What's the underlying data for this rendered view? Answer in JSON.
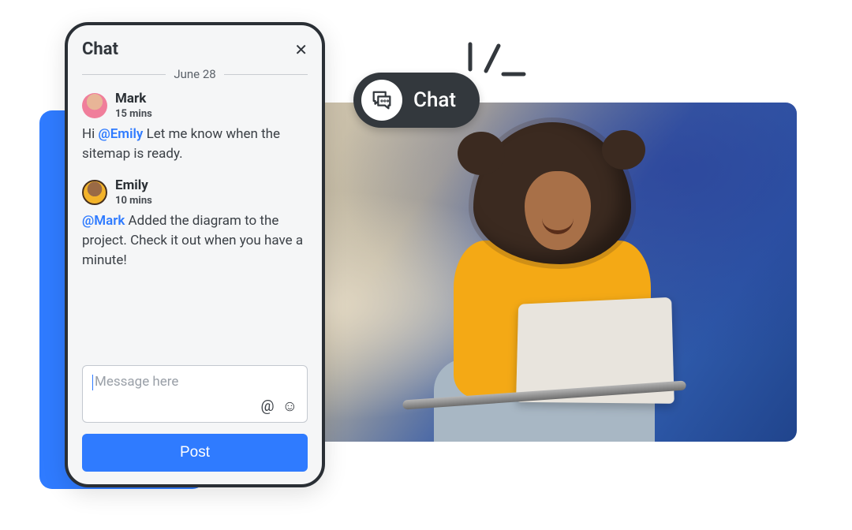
{
  "chat": {
    "title": "Chat",
    "date_label": "June 28",
    "messages": [
      {
        "author": "Mark",
        "time": "15 mins",
        "body_prefix": "Hi ",
        "mention": "@Emily",
        "body_suffix": " Let me know when the sitemap is ready.",
        "avatar": "av1"
      },
      {
        "author": "Emily",
        "time": "10 mins",
        "body_prefix": "",
        "mention": "@Mark",
        "body_suffix": " Added the diagram to the project. Check it out when you have a minute!",
        "avatar": "av2"
      }
    ],
    "input_placeholder": "Message here",
    "post_label": "Post"
  },
  "pill": {
    "label": "Chat"
  },
  "icons": {
    "at": "@",
    "emoji": "☺"
  }
}
